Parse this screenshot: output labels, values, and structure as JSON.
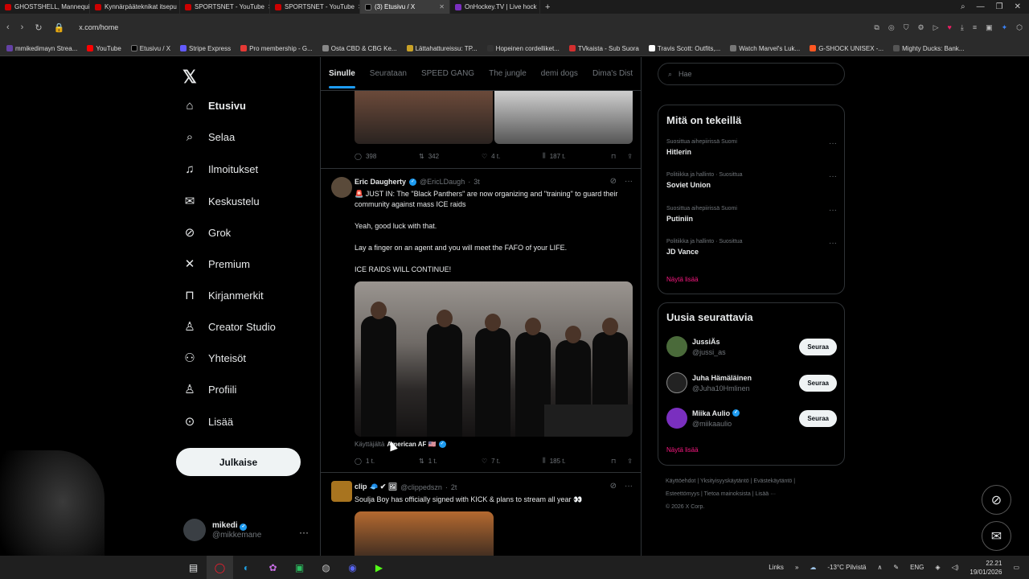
{
  "browser": {
    "tabs": [
      {
        "label": "GHOSTSHELL, Mannequin",
        "color": "#cc0000"
      },
      {
        "label": "Kynnärpääteknikat itsepu",
        "color": "#cc0000"
      },
      {
        "label": "SPORTSNET - YouTube",
        "color": "#cc0000"
      },
      {
        "label": "SPORTSNET - YouTube",
        "color": "#cc0000"
      },
      {
        "label": "(3) Etusivu / X",
        "color": "#000000"
      },
      {
        "label": "OnHockey.TV | Live hock",
        "color": "#7a2fbf"
      }
    ],
    "url": "x.com/home",
    "bookmarks": [
      {
        "label": "mmikedimayn Strea...",
        "color": "#6441a5"
      },
      {
        "label": "YouTube",
        "color": "#ff0000"
      },
      {
        "label": "Etusivu / X",
        "color": "#000000"
      },
      {
        "label": "Stripe Express",
        "color": "#635bff"
      },
      {
        "label": "Pro membership - G...",
        "color": "#e53935"
      },
      {
        "label": "Osta CBD & CBG Ke...",
        "color": "#888888"
      },
      {
        "label": "Lättahattureissu: TP...",
        "color": "#c9a227"
      },
      {
        "label": "Hopeinen cordelliket...",
        "color": "#333333"
      },
      {
        "label": "TVkaista - Sub Suora",
        "color": "#d32f2f"
      },
      {
        "label": "Travis Scott: Outfits,...",
        "color": "#ffffff"
      },
      {
        "label": "Watch Marvel's Luk...",
        "color": "#777777"
      },
      {
        "label": "G-SHOCK UNISEX -...",
        "color": "#ff5722"
      },
      {
        "label": "Mighty Ducks: Bank...",
        "color": "#555555"
      }
    ]
  },
  "sidebar": {
    "items": [
      {
        "label": "Etusivu",
        "icon": "home-icon",
        "glyph": "⌂"
      },
      {
        "label": "Selaa",
        "icon": "search-icon",
        "glyph": "⌕"
      },
      {
        "label": "Ilmoitukset",
        "icon": "bell-icon",
        "glyph": "♪"
      },
      {
        "label": "Keskustelu",
        "icon": "mail-icon",
        "glyph": "✉"
      },
      {
        "label": "Grok",
        "icon": "grok-icon",
        "glyph": "⊘"
      },
      {
        "label": "Premium",
        "icon": "x-icon",
        "glyph": "✕"
      },
      {
        "label": "Kirjanmerkit",
        "icon": "bookmark-icon",
        "glyph": "⊓"
      },
      {
        "label": "Creator Studio",
        "icon": "creator-icon",
        "glyph": "♙"
      },
      {
        "label": "Yhteisöt",
        "icon": "communities-icon",
        "glyph": "⚇"
      },
      {
        "label": "Profiili",
        "icon": "profile-icon",
        "glyph": "♙"
      },
      {
        "label": "Lisää",
        "icon": "more-icon",
        "glyph": "⊙"
      }
    ],
    "post_label": "Julkaise",
    "profile": {
      "name": "mikedi",
      "handle": "@mikkemane"
    }
  },
  "feed": {
    "tabs": [
      "Sinulle",
      "Seurataan",
      "SPEED GANG",
      "The jungle",
      "demi dogs",
      "Dima's Dist"
    ],
    "prev_actions": {
      "replies": "398",
      "reposts": "342",
      "likes": "4 t.",
      "views": "187 t."
    },
    "tweet1": {
      "name": "Eric Daugherty",
      "handle": "@EricLDaugh",
      "time": "3t",
      "lines": [
        "🚨 JUST IN: The \"Black Panthers\" are now organizing and \"training\" to guard their community against mass ICE raids",
        "Yeah, good luck with that.",
        "Lay a finger on an agent and you will meet the FAFO of your LIFE.",
        "ICE RAIDS WILL CONTINUE!"
      ],
      "from_prefix": "Käyttäjältä",
      "from_name": "American AF 🇺🇸",
      "actions": {
        "replies": "1 t.",
        "reposts": "1 t.",
        "likes": "7 t.",
        "views": "185 t."
      }
    },
    "tweet2": {
      "name": "clip 🧢 ✔ 🖼",
      "handle": "@clippedszn",
      "time": "2t",
      "text": "Soulja Boy has officially signed with KICK & plans to stream all year 👀"
    }
  },
  "right": {
    "search_placeholder": "Hae",
    "trends_title": "Mitä on tekeillä",
    "trends": [
      {
        "category": "Suosittua aihepiirissä Suomi",
        "title": "Hitlerin"
      },
      {
        "category": "Politiikka ja hallinto · Suosittua",
        "title": "Soviet Union"
      },
      {
        "category": "Suosittua aihepiirissä Suomi",
        "title": "Putiniin"
      },
      {
        "category": "Politiikka ja hallinto · Suosittua",
        "title": "JD Vance"
      }
    ],
    "show_more": "Näytä lisää",
    "who_title": "Uusia seurattavia",
    "who": [
      {
        "name": "JussiÄs",
        "handle": "@jussi_as",
        "verified": false
      },
      {
        "name": "Juha Hämäläinen",
        "handle": "@Juha10Hmlinen",
        "verified": false
      },
      {
        "name": "Miika Aulio",
        "handle": "@miikaaulio",
        "verified": true
      }
    ],
    "follow_label": "Seuraa",
    "footer": [
      "Käyttöehdot",
      "Yksityisyyskäytäntö",
      "Evästekäytäntö",
      "Esteettömyys",
      "Tietoa mainoksista",
      "Lisää ···",
      "© 2026 X Corp."
    ]
  },
  "taskbar": {
    "links": "Links",
    "weather": "-13°C Pilvistä",
    "lang": "ENG",
    "time": "22.21",
    "date": "19/01/2026"
  }
}
